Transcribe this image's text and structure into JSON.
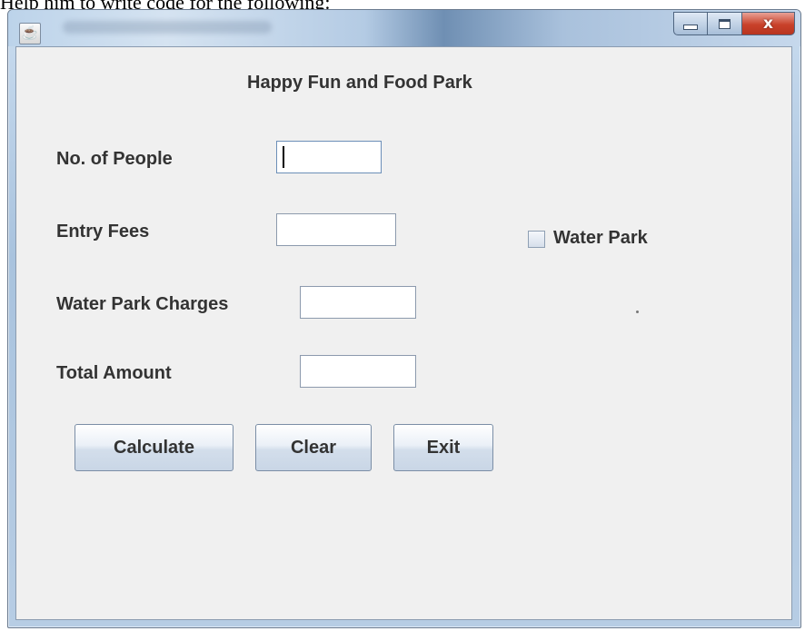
{
  "document": {
    "caption": "Help him to write code for the following:"
  },
  "window": {
    "title": "",
    "controls": {
      "minimize": "–",
      "maximize": "□",
      "close": "x"
    }
  },
  "form": {
    "heading": "Happy Fun and Food Park",
    "fields": {
      "people": {
        "label": "No. of People",
        "value": ""
      },
      "entry_fees": {
        "label": "Entry Fees",
        "value": ""
      },
      "water_park_charges": {
        "label": "Water Park Charges",
        "value": ""
      },
      "total_amount": {
        "label": "Total Amount",
        "value": ""
      }
    },
    "checkbox": {
      "label": "Water Park",
      "checked": false
    },
    "buttons": {
      "calculate": "Calculate",
      "clear": "Clear",
      "exit": "Exit"
    }
  },
  "icons": {
    "app": "java-cup-icon",
    "minimize": "minimize-icon",
    "maximize": "maximize-icon",
    "close": "close-icon"
  },
  "colors": {
    "close_button": "#c9412a",
    "panel_background": "#f0f0f0",
    "title_gradient": "#a9c3de"
  }
}
